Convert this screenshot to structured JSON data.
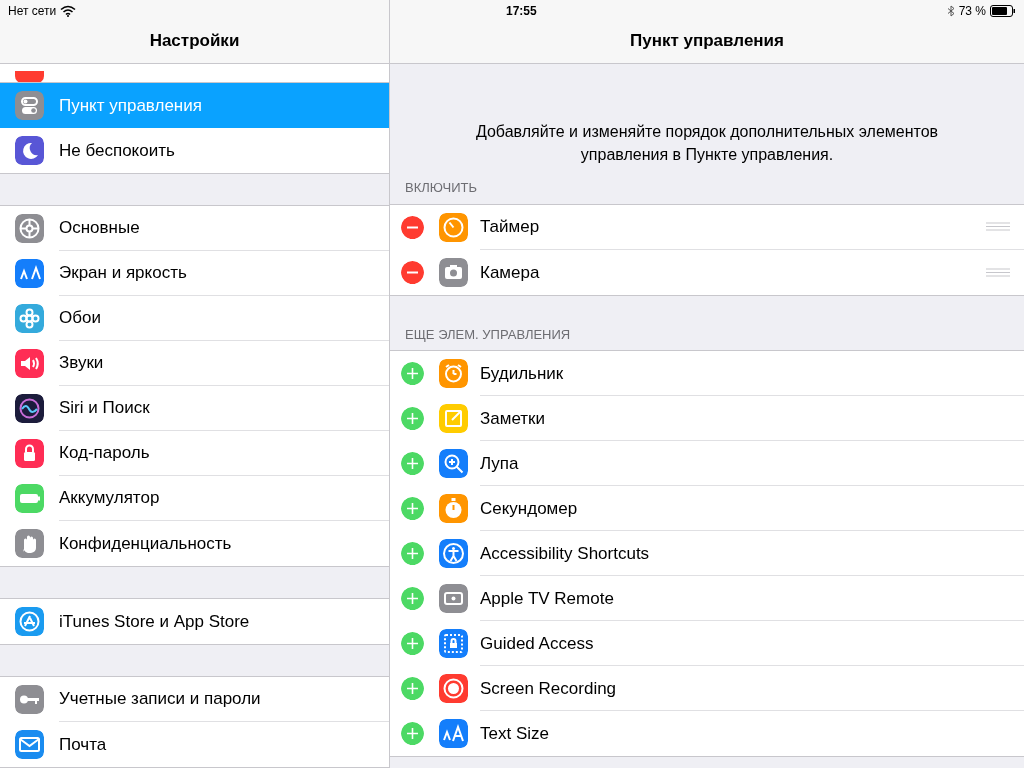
{
  "status_bar": {
    "carrier": "Нет сети",
    "time": "17:55",
    "battery": "73 %"
  },
  "sidebar": {
    "title": "Настройки",
    "groups": [
      {
        "items": [
          {
            "label": "Пункт управления",
            "color": "#8e8e93",
            "selected": true
          },
          {
            "label": "Не беспокоить",
            "color": "#5856d6",
            "selected": false
          }
        ]
      },
      {
        "items": [
          {
            "label": "Основные",
            "color": "#8e8e93",
            "selected": false
          },
          {
            "label": "Экран и яркость",
            "color": "#147efb",
            "selected": false
          },
          {
            "label": "Обои",
            "color": "#34aadc",
            "selected": false
          },
          {
            "label": "Звуки",
            "color": "#ff2d55",
            "selected": false
          },
          {
            "label": "Siri и Поиск",
            "color": "#1c1c3c",
            "selected": false
          },
          {
            "label": "Код-пароль",
            "color": "#ff2d55",
            "selected": false
          },
          {
            "label": "Аккумулятор",
            "color": "#4cd964",
            "selected": false
          },
          {
            "label": "Конфиденциальность",
            "color": "#8e8e93",
            "selected": false
          }
        ]
      },
      {
        "items": [
          {
            "label": "iTunes Store и App Store",
            "color": "#1a9bf0",
            "selected": false
          }
        ]
      },
      {
        "items": [
          {
            "label": "Учетные записи и пароли",
            "color": "#8e8e93",
            "selected": false
          },
          {
            "label": "Почта",
            "color": "#1a8cf0",
            "selected": false
          }
        ]
      }
    ]
  },
  "detail": {
    "title": "Пункт управления",
    "description": "Добавляйте и изменяйте порядок дополнительных элементов управления в Пункте управления.",
    "sections": [
      {
        "header": "ВКЛЮЧИТЬ",
        "rows": [
          {
            "label": "Таймер",
            "color": "#ff9500",
            "included": true
          },
          {
            "label": "Камера",
            "color": "#8e8e93",
            "included": true
          }
        ]
      },
      {
        "header": "ЕЩЕ ЭЛЕМ. УПРАВЛЕНИЯ",
        "rows": [
          {
            "label": "Будильник",
            "color": "#ff9500",
            "included": false
          },
          {
            "label": "Заметки",
            "color": "#ffcc00",
            "included": false
          },
          {
            "label": "Лупа",
            "color": "#147efb",
            "included": false
          },
          {
            "label": "Секундомер",
            "color": "#ff9500",
            "included": false
          },
          {
            "label": "Accessibility Shortcuts",
            "color": "#147efb",
            "included": false
          },
          {
            "label": "Apple TV Remote",
            "color": "#8e8e93",
            "included": false
          },
          {
            "label": "Guided Access",
            "color": "#147efb",
            "included": false
          },
          {
            "label": "Screen Recording",
            "color": "#ff3b30",
            "included": false
          },
          {
            "label": "Text Size",
            "color": "#147efb",
            "included": false
          }
        ]
      }
    ]
  }
}
